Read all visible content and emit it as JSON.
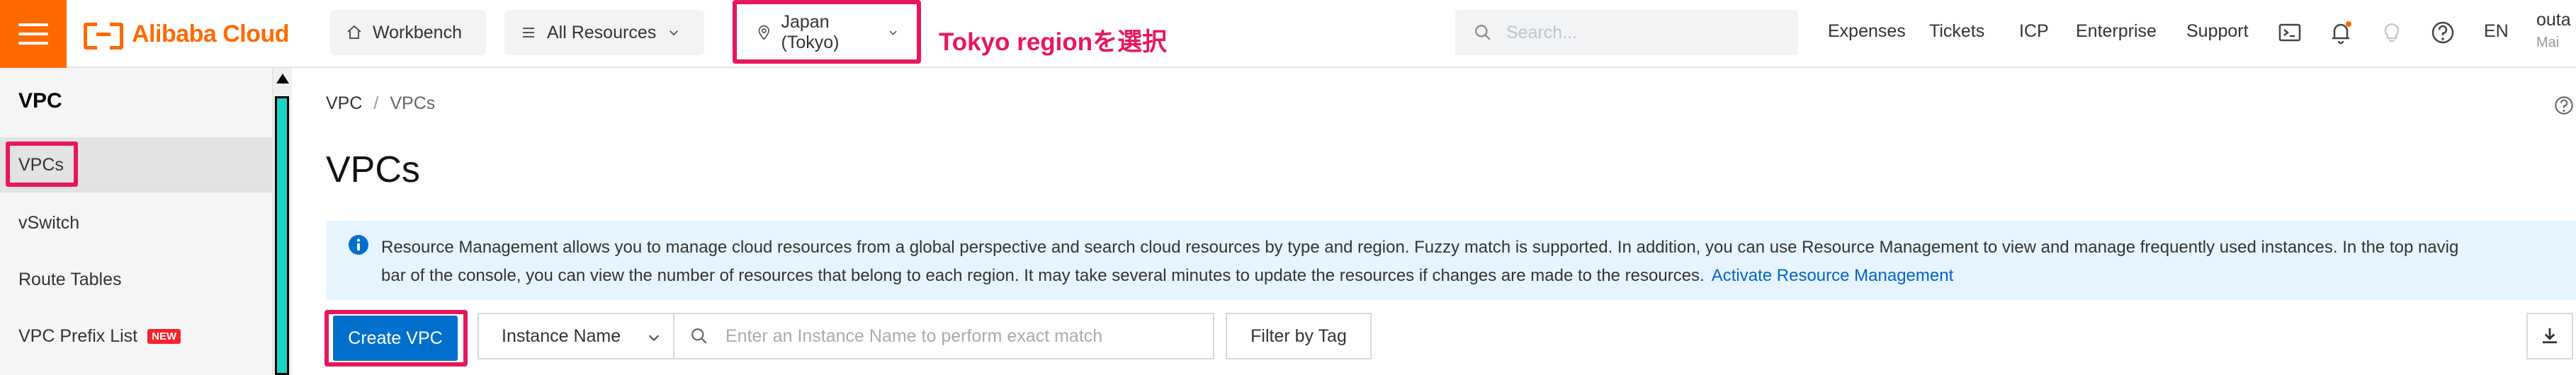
{
  "topbar": {
    "brand": "Alibaba Cloud",
    "workbench": "Workbench",
    "all_resources": "All Resources",
    "region": "Japan (Tokyo)",
    "region_annotation": "Tokyo regionを選択",
    "search_placeholder": "Search...",
    "links": [
      "Expenses",
      "Tickets",
      "ICP",
      "Enterprise",
      "Support"
    ],
    "language": "EN",
    "user": "outa",
    "user_sub": "Mai"
  },
  "sidebar": {
    "title": "VPC",
    "items": [
      {
        "label": "VPCs"
      },
      {
        "label": "vSwitch"
      },
      {
        "label": "Route Tables"
      },
      {
        "label": "VPC Prefix List",
        "badge": "NEW"
      }
    ]
  },
  "main": {
    "breadcrumb": [
      "VPC",
      "VPCs"
    ],
    "title": "VPCs",
    "notice": {
      "line1": "Resource Management allows you to manage cloud resources from a global perspective and search cloud resources by type and region. Fuzzy match is supported. In addition, you can use Resource Management to view and manage frequently used instances. In the top navig",
      "line2": "bar of the console, you can view the number of resources that belong to each region. It may take several minutes to update the resources if changes are made to the resources.",
      "link": "Activate Resource Management"
    },
    "toolbar": {
      "create": "Create VPC",
      "filter_field": "Instance Name",
      "search_placeholder": "Enter an Instance Name to perform exact match",
      "filter_tag": "Filter by Tag"
    }
  },
  "colors": {
    "brand": "#ff6a00",
    "annotation": "#e8175d",
    "primary": "#0070cc",
    "notice_bg": "#e6f4ff"
  }
}
